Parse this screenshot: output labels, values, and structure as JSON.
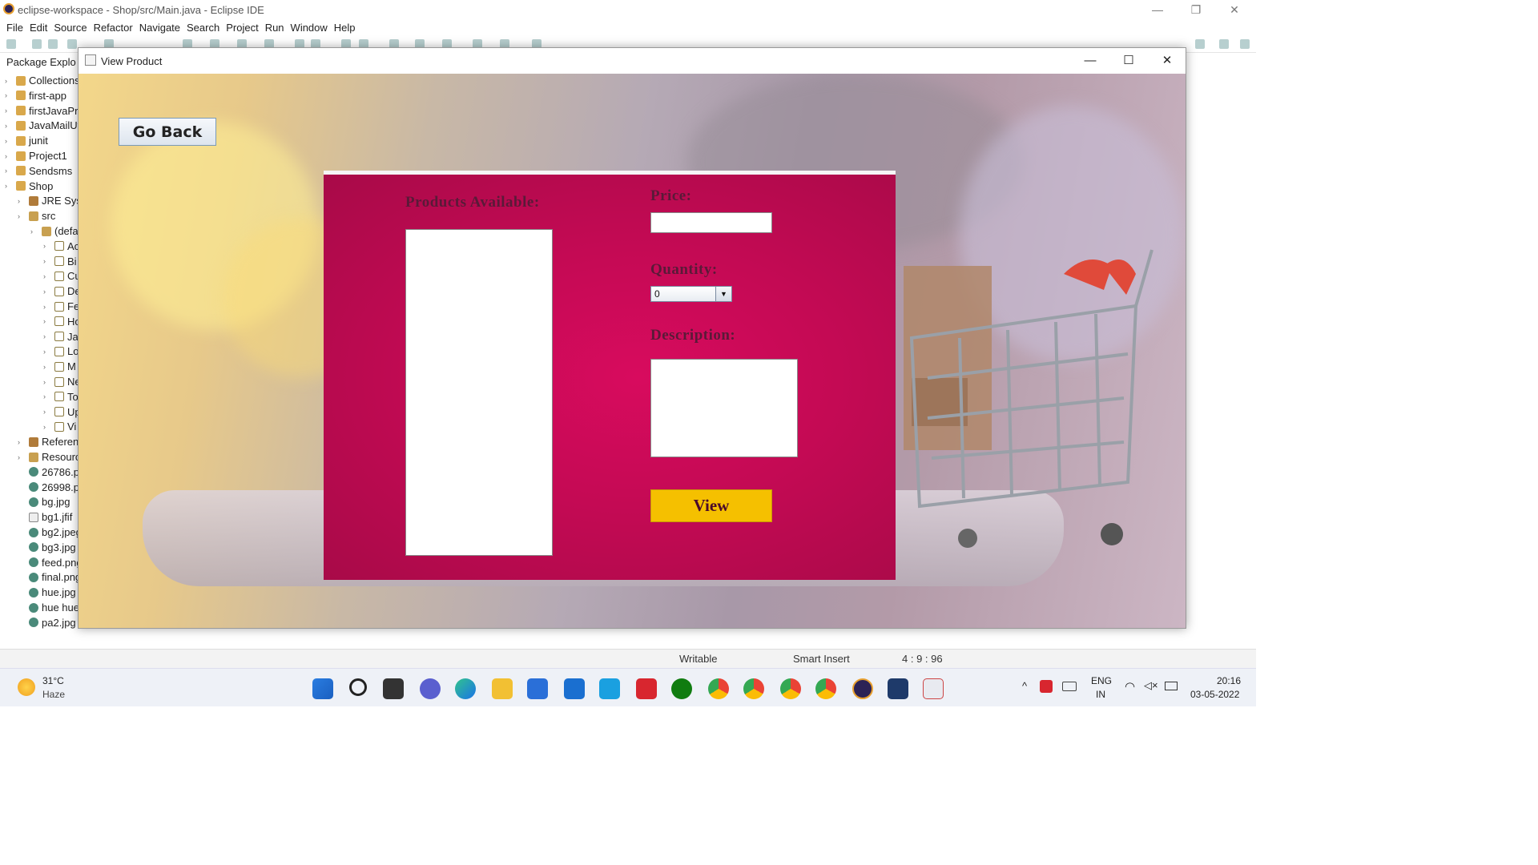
{
  "eclipse": {
    "title": "eclipse-workspace - Shop/src/Main.java - Eclipse IDE",
    "menu": [
      "File",
      "Edit",
      "Source",
      "Refactor",
      "Navigate",
      "Search",
      "Project",
      "Run",
      "Window",
      "Help"
    ],
    "package_explorer_tab": "Package Explo",
    "tree": [
      {
        "label": "Collections",
        "icon": "project-icon",
        "indent": 0
      },
      {
        "label": "first-app",
        "icon": "project-icon",
        "indent": 0
      },
      {
        "label": "firstJavaPro",
        "icon": "project-icon",
        "indent": 0
      },
      {
        "label": "JavaMailUt",
        "icon": "project-icon",
        "indent": 0
      },
      {
        "label": "junit",
        "icon": "project-icon",
        "indent": 0
      },
      {
        "label": "Project1",
        "icon": "project-icon",
        "indent": 0
      },
      {
        "label": "Sendsms",
        "icon": "project-icon",
        "indent": 0
      },
      {
        "label": "Shop",
        "icon": "project-icon",
        "indent": 0
      },
      {
        "label": "JRE Syste",
        "icon": "library-icon",
        "indent": 1
      },
      {
        "label": "src",
        "icon": "package-icon",
        "indent": 1
      },
      {
        "label": "(defa",
        "icon": "package-icon",
        "indent": 2
      },
      {
        "label": "Ac",
        "icon": "java-file-icon",
        "indent": 3
      },
      {
        "label": "Bi",
        "icon": "java-file-icon",
        "indent": 3
      },
      {
        "label": "Cu",
        "icon": "java-file-icon",
        "indent": 3
      },
      {
        "label": "De",
        "icon": "java-file-icon",
        "indent": 3
      },
      {
        "label": "Fe",
        "icon": "java-file-icon",
        "indent": 3
      },
      {
        "label": "Ho",
        "icon": "java-file-icon",
        "indent": 3
      },
      {
        "label": "Ja",
        "icon": "java-file-icon",
        "indent": 3
      },
      {
        "label": "Lo",
        "icon": "java-file-icon",
        "indent": 3
      },
      {
        "label": "M",
        "icon": "java-file-icon",
        "indent": 3
      },
      {
        "label": "Ne",
        "icon": "java-file-icon",
        "indent": 3
      },
      {
        "label": "To",
        "icon": "java-file-icon",
        "indent": 3
      },
      {
        "label": "Up",
        "icon": "java-file-icon",
        "indent": 3
      },
      {
        "label": "Vi",
        "icon": "java-file-icon",
        "indent": 3
      },
      {
        "label": "Referen",
        "icon": "library-icon",
        "indent": 1
      },
      {
        "label": "Resourc",
        "icon": "folder-icon",
        "indent": 1
      },
      {
        "label": "26786.p",
        "icon": "image-file-icon",
        "indent": 1
      },
      {
        "label": "26998.p",
        "icon": "image-file-icon",
        "indent": 1
      },
      {
        "label": "bg.jpg",
        "icon": "image-file-icon",
        "indent": 1
      },
      {
        "label": "bg1.jfif",
        "icon": "file-icon",
        "indent": 1
      },
      {
        "label": "bg2.jpeg",
        "icon": "image-file-icon",
        "indent": 1
      },
      {
        "label": "bg3.jpg",
        "icon": "image-file-icon",
        "indent": 1
      },
      {
        "label": "feed.png",
        "icon": "image-file-icon",
        "indent": 1
      },
      {
        "label": "final.png",
        "icon": "image-file-icon",
        "indent": 1
      },
      {
        "label": "hue.jpg",
        "icon": "image-file-icon",
        "indent": 1
      },
      {
        "label": "hue hue.",
        "icon": "image-file-icon",
        "indent": 1
      },
      {
        "label": "pa2.jpg",
        "icon": "image-file-icon",
        "indent": 1
      }
    ],
    "status": {
      "writable": "Writable",
      "insert_mode": "Smart Insert",
      "position": "4 : 9 : 96"
    }
  },
  "dialog": {
    "title": "View Product",
    "go_back_label": "Go Back",
    "products_label": "Products Available:",
    "price_label": "Price:",
    "price_value": "",
    "quantity_label": "Quantity:",
    "quantity_value": "0",
    "description_label": "Description:",
    "view_label": "View",
    "colors": {
      "panel": "#c90a55",
      "view_button": "#f5c000",
      "label": "#5a1a38"
    }
  },
  "taskbar": {
    "weather_temp": "31°C",
    "weather_desc": "Haze",
    "lang": "ENG",
    "region": "IN",
    "time": "20:16",
    "date": "03-05-2022"
  }
}
